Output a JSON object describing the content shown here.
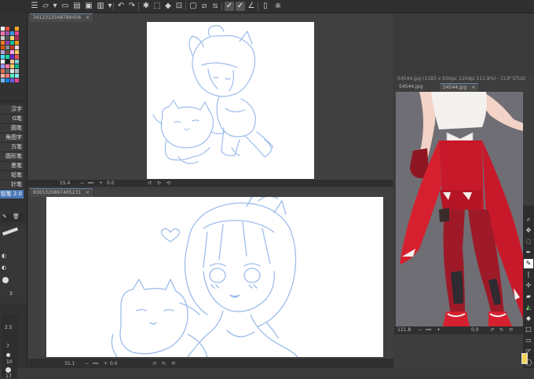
{
  "toolbar": {
    "icons": [
      "menu-icon",
      "new-file-icon",
      "open-file-icon",
      "save-icon",
      "export-icon",
      "undo-icon",
      "redo-icon",
      "transform-icon",
      "clear-icon",
      "fill-icon",
      "crop-icon",
      "hide-selection-icon",
      "select-all-icon",
      "deselect-icon",
      "confirm-icon",
      "ruler-icon",
      "snap-icon",
      "tablet-icon",
      "web-icon"
    ]
  },
  "left_panel": {
    "menu_items": [
      "汉字",
      "G笔",
      "圆笔",
      "角图字",
      "方笔",
      "圆形笔",
      "墨笔",
      "铅笔",
      "针笔",
      "铅笔 2.0"
    ],
    "selected_index": 9,
    "size_label": "3",
    "brush_sizes": [
      "2.5",
      "7",
      "10",
      "17"
    ]
  },
  "windows": [
    {
      "tab": "3412312548789456",
      "status": {
        "zoom": "15.4",
        "angle": "0.0"
      }
    },
    {
      "tab": "6565329897465231",
      "status": {
        "zoom": "31.1",
        "angle": "0.0"
      }
    },
    {
      "title": "54544.jpg (1183 x 930px 120dpi 111.8%) - CLIP STUD",
      "tabs": [
        "54544.jpg",
        "54544.jpg"
      ],
      "status": {
        "zoom": "111.8",
        "angle": "0.0"
      }
    }
  ],
  "colors": {
    "sketch": "#9dbcea",
    "app_bg": "#3a3a3a",
    "tab_accent": "#6f86a8",
    "red": "#c8192b",
    "dark_red": "#8e1623",
    "photo_bg": "#6f6e74"
  }
}
